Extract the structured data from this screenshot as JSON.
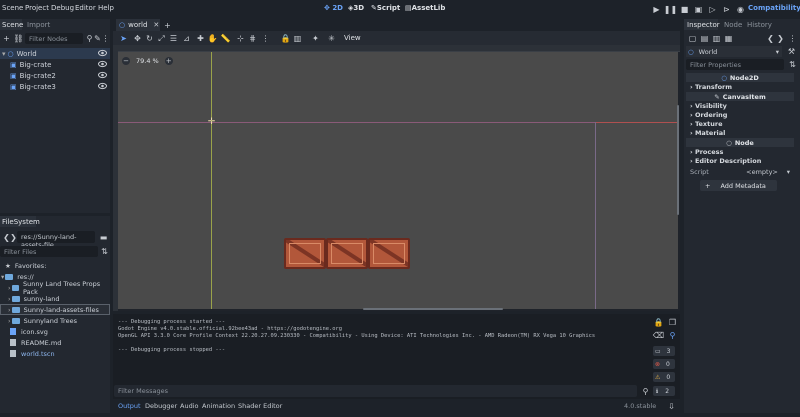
{
  "menubar": {
    "items": [
      "Scene",
      "Project",
      "Debug",
      "Editor",
      "Help"
    ],
    "workspaces": [
      "2D",
      "3D",
      "Script",
      "AssetLib"
    ],
    "renderer": "Compatibility"
  },
  "scene_dock": {
    "tabs": [
      "Scene",
      "Import"
    ],
    "filter_placeholder": "Filter Nodes",
    "nodes": [
      "World",
      "Big-crate",
      "Big-crate2",
      "Big-crate3"
    ]
  },
  "filesystem": {
    "tab": "FileSystem",
    "path": "res://Sunny-land-assets-file",
    "filter_placeholder": "Filter Files",
    "items": [
      {
        "label": "Favorites:",
        "type": "star"
      },
      {
        "label": "res://",
        "type": "folder"
      },
      {
        "label": "Sunny Land Trees Props Pack",
        "type": "folder"
      },
      {
        "label": "sunny-land",
        "type": "folder"
      },
      {
        "label": "Sunny-land-assets-files",
        "type": "folder"
      },
      {
        "label": "Sunnyland Trees",
        "type": "folder"
      },
      {
        "label": "icon.svg",
        "type": "file"
      },
      {
        "label": "README.md",
        "type": "file"
      },
      {
        "label": "world.tscn",
        "type": "file"
      }
    ]
  },
  "editor": {
    "scene_tab": "world",
    "view_menu": "View",
    "zoom": "79.4 %"
  },
  "console": {
    "lines": [
      "--- Debugging process started ---",
      "Godot Engine v4.0.stable.official.92bee43ad - https://godotengine.org",
      "OpenGL API 3.3.0 Core Profile Context 22.20.27.09.230330 - Compatibility - Using Device: ATI Technologies Inc. - AMD Radeon(TM) RX Vega 10 Graphics",
      "",
      "--- Debugging process stopped ---"
    ],
    "filter_placeholder": "Filter Messages",
    "counts": {
      "messages": "3",
      "errors": "0",
      "warnings": "0",
      "info": "2"
    }
  },
  "bottom_tabs": [
    "Output",
    "Debugger",
    "Audio",
    "Animation",
    "Shader Editor"
  ],
  "version": "4.0.stable",
  "inspector": {
    "tabs": [
      "Inspector",
      "Node",
      "History"
    ],
    "node_name": "World",
    "filter_placeholder": "Filter Properties",
    "class_node2d": "Node2D",
    "sec_transform": "Transform",
    "class_canvasitem": "CanvasItem",
    "sec_visibility": "Visibility",
    "sec_ordering": "Ordering",
    "sec_texture": "Texture",
    "sec_material": "Material",
    "class_node": "Node",
    "sec_process": "Process",
    "sec_editor_description": "Editor Description",
    "script_label": "Script",
    "script_value": "<empty>",
    "add_metadata": "Add Metadata"
  },
  "colors": {
    "accent": "#6aa3f7",
    "background": "#1d2229",
    "viewport": "#4a4a4a",
    "crate": "#b2573a"
  }
}
